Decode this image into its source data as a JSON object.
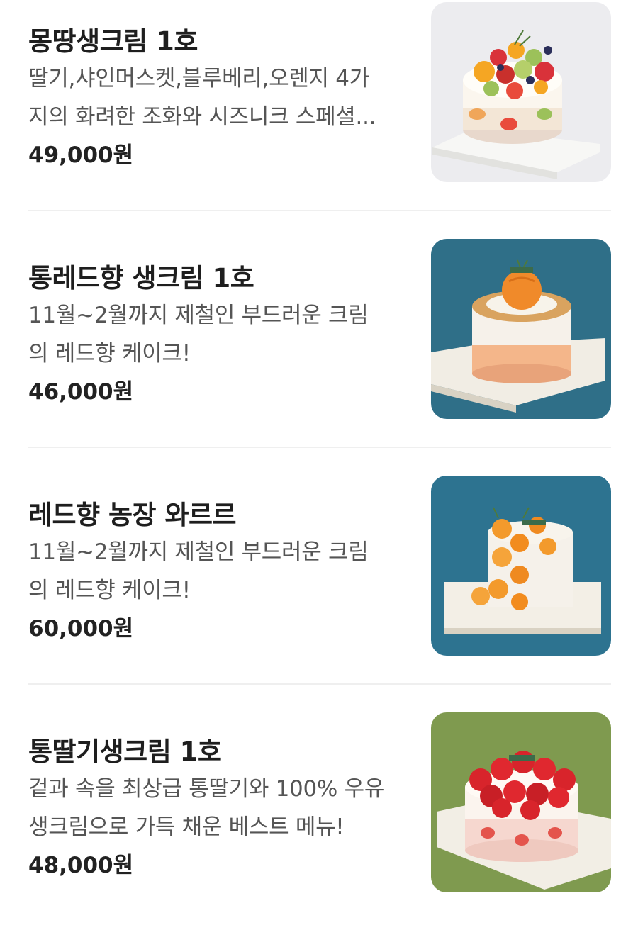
{
  "items": [
    {
      "name": "몽땅생크림 1호",
      "desc_lines": [
        "딸기,샤인머스켓,블루베리,오렌지 4가",
        "지의 화려한 조화와 시즈니크 스페셜..."
      ],
      "price": "49,000원",
      "image_icon": "fruit-cake-image"
    },
    {
      "name": "통레드향 생크림 1호",
      "desc_lines": [
        "11월~2월까지 제철인 부드러운 크림",
        "의 레드향 케이크!"
      ],
      "price": "46,000원",
      "image_icon": "redhyang-cake-image"
    },
    {
      "name": "레드향 농장 와르르",
      "desc_lines": [
        "11월~2월까지 제철인 부드러운 크림",
        "의 레드향 케이크!"
      ],
      "price": "60,000원",
      "image_icon": "tangerine-cake-image"
    },
    {
      "name": "통딸기생크림 1호",
      "desc_lines": [
        "겉과 속을 최상급 통딸기와 100% 우유",
        "생크림으로 가득 채운 베스트 메뉴!"
      ],
      "price": "48,000원",
      "image_icon": "strawberry-cake-image"
    }
  ],
  "colors": {
    "title": "#1e1e1e",
    "description": "#555555",
    "price": "#222222",
    "divider": "#efefef",
    "thumb_bg_1": "#ececef",
    "thumb_bg_2": "#2f6f88",
    "thumb_bg_3": "#2d7390",
    "thumb_bg_4": "#7f9a4f"
  }
}
